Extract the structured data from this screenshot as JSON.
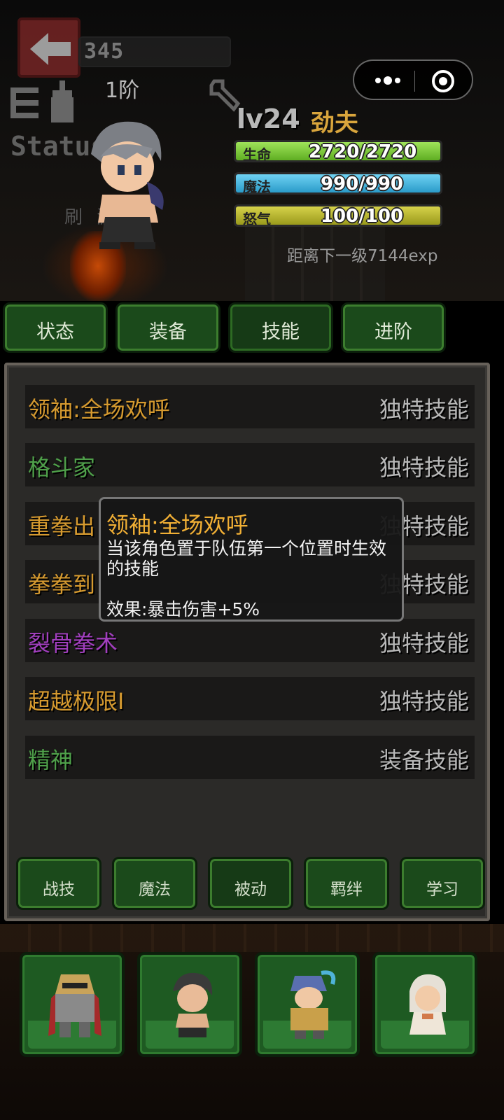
{
  "header": {
    "power_value": "345",
    "rank": "1阶",
    "logo_text": "Status",
    "watermark_text": "刷    游戏",
    "level": "lv24",
    "job": "劲夫",
    "exp_text": "距离下一级7144exp"
  },
  "stats": {
    "hp": {
      "label": "生命",
      "value": "2720/2720",
      "fill": 1.0
    },
    "mp": {
      "label": "魔法",
      "value": "990/990",
      "fill": 1.0
    },
    "rage": {
      "label": "怒气",
      "value": "100/100",
      "fill": 1.0
    }
  },
  "miniapp": {
    "more_icon": "more-dots-icon",
    "close_icon": "target-icon"
  },
  "main_tabs": [
    {
      "label": "状态"
    },
    {
      "label": "装备"
    },
    {
      "label": "技能"
    },
    {
      "label": "进阶"
    }
  ],
  "skills": [
    {
      "name": "领袖:全场欢呼",
      "type": "独特技能",
      "color": "#d69a2f"
    },
    {
      "name": "格斗家",
      "type": "独特技能",
      "color": "#4fa04a"
    },
    {
      "name": "重拳出",
      "type": "独特技能",
      "color": "#d69a2f"
    },
    {
      "name": "拳拳到",
      "type": "独特技能",
      "color": "#d69a2f"
    },
    {
      "name": "裂骨拳术",
      "type": "独特技能",
      "color": "#a23fbf"
    },
    {
      "name": "超越极限I",
      "type": "独特技能",
      "color": "#d69a2f"
    },
    {
      "name": "精神",
      "type": "装备技能",
      "color": "#4fa04a"
    }
  ],
  "tooltip": {
    "title": "领袖:全场欢呼",
    "description": "当该角色置于队伍第一个位置时生效的技能",
    "effect": "效果:暴击伤害+5%"
  },
  "skill_tabs": [
    {
      "label": "战技"
    },
    {
      "label": "魔法"
    },
    {
      "label": "被动"
    },
    {
      "label": "羁绊"
    },
    {
      "label": "学习"
    }
  ],
  "colors": {
    "accent_green": "#1e5a22",
    "gold": "#d69a2f",
    "tooltip_title": "#f2b035"
  }
}
